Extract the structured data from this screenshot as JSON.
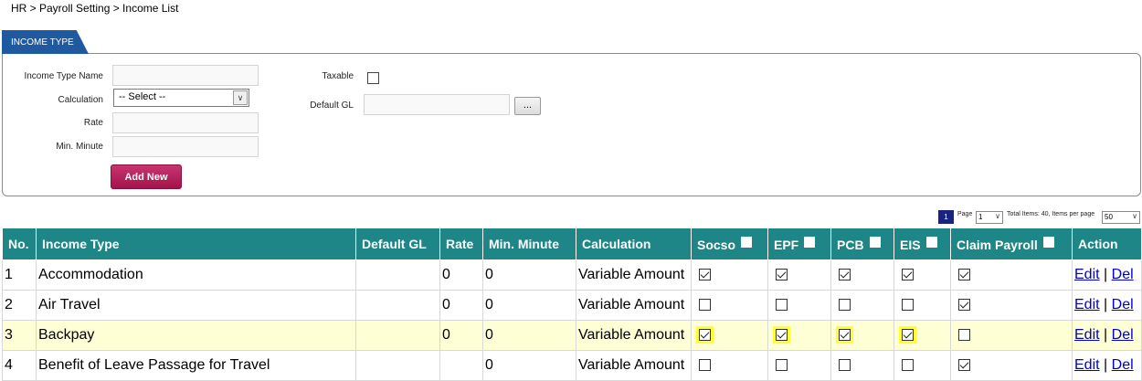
{
  "breadcrumb": "HR > Payroll Setting > Income List",
  "tab_label": "INCOME TYPE",
  "form": {
    "income_type_name_label": "Income Type Name",
    "calculation_label": "Calculation",
    "calculation_value": "-- Select --",
    "rate_label": "Rate",
    "min_minute_label": "Min. Minute",
    "taxable_label": "Taxable",
    "default_gl_label": "Default GL",
    "browse_label": "...",
    "add_new_label": "Add New"
  },
  "pager": {
    "current": "1",
    "page_label": "Page",
    "page_value": "1",
    "summary": "Total Items: 40, Items per page",
    "per_page": "50"
  },
  "table": {
    "headers": [
      "No.",
      "Income Type",
      "Default GL",
      "Rate",
      "Min. Minute",
      "Calculation",
      "Socso",
      "EPF",
      "PCB",
      "EIS",
      "Claim Payroll",
      "Action"
    ],
    "edit_label": "Edit",
    "sep": "|",
    "del_label": "Del",
    "rows": [
      {
        "no": "1",
        "type": "Accommodation",
        "gl": "",
        "rate": "0",
        "min": "0",
        "calc": "Variable Amount",
        "socso": true,
        "epf": true,
        "pcb": true,
        "eis": true,
        "claim": true
      },
      {
        "no": "2",
        "type": "Air Travel",
        "gl": "",
        "rate": "0",
        "min": "0",
        "calc": "Variable Amount",
        "socso": false,
        "epf": false,
        "pcb": false,
        "eis": false,
        "claim": true
      },
      {
        "no": "3",
        "type": "Backpay",
        "gl": "",
        "rate": "0",
        "min": "0",
        "calc": "Variable Amount",
        "socso": true,
        "epf": true,
        "pcb": true,
        "eis": true,
        "claim": false
      },
      {
        "no": "4",
        "type": "Benefit of Leave Passage for Travel",
        "gl": "",
        "rate": "",
        "min": "0",
        "calc": "Variable Amount",
        "socso": false,
        "epf": false,
        "pcb": false,
        "eis": false,
        "claim": true
      }
    ]
  },
  "colors": {
    "header_teal": "#1e8686",
    "tab_blue": "#1f5aa0",
    "button_magenta": "#b52460",
    "highlight_row": "#ffffd6",
    "marker_yellow": "#ffff33"
  }
}
